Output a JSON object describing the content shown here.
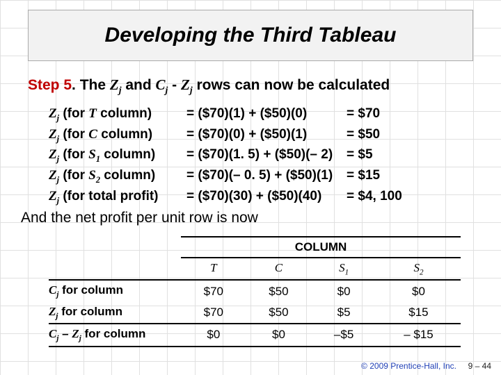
{
  "title": "Developing the Third Tableau",
  "step": {
    "label": "Step 5",
    "period": ".",
    "pre": " The ",
    "z": "Z",
    "jsub": "j",
    "and": " and ",
    "c": "C",
    "dash": " - ",
    "post": " rows can now be calculated"
  },
  "calcs": [
    {
      "lhs_var": "Z",
      "lhs_sub": "j",
      "lhs_for": " (for ",
      "lhs_col": "T",
      "lhs_tail": " column)",
      "mid": "= ($70)(1) + ($50)(0)",
      "rhs": "= $70"
    },
    {
      "lhs_var": "Z",
      "lhs_sub": "j",
      "lhs_for": " (for ",
      "lhs_col": "C",
      "lhs_tail": " column)",
      "mid": "= ($70)(0) + ($50)(1)",
      "rhs": "= $50"
    },
    {
      "lhs_var": "Z",
      "lhs_sub": "j",
      "lhs_for": " (for ",
      "lhs_col": "S",
      "lhs_colsub": "1",
      "lhs_tail": " column)",
      "mid": "= ($70)(1. 5) + ($50)(– 2)",
      "rhs": "= $5"
    },
    {
      "lhs_var": "Z",
      "lhs_sub": "j",
      "lhs_for": " (for ",
      "lhs_col": "S",
      "lhs_colsub": "2",
      "lhs_tail": " column)",
      "mid": "= ($70)(– 0. 5) + ($50)(1)",
      "rhs": "= $15"
    },
    {
      "lhs_var": "Z",
      "lhs_sub": "j",
      "lhs_for": " (for total profit)",
      "lhs_col": "",
      "lhs_tail": "",
      "mid": "= ($70)(30) + ($50)(40)",
      "rhs": "= $4, 100"
    }
  ],
  "net_line": "And the net profit per unit row is now",
  "table": {
    "column_header": "COLUMN",
    "cols": [
      {
        "name": "T",
        "sub": ""
      },
      {
        "name": "C",
        "sub": ""
      },
      {
        "name": "S",
        "sub": "1"
      },
      {
        "name": "S",
        "sub": "2"
      }
    ],
    "rows": [
      {
        "label_var": "C",
        "label_sub": "j",
        "label_tail": " for column",
        "vals": [
          "$70",
          "$50",
          "$0",
          "$0"
        ]
      },
      {
        "label_var": "Z",
        "label_sub": "j",
        "label_tail": " for column",
        "vals": [
          "$70",
          "$50",
          "$5",
          "$15"
        ]
      },
      {
        "label_var": "C",
        "label_sub": "j",
        "label_mid": " – ",
        "label_var2": "Z",
        "label_sub2": "j",
        "label_tail": " for column",
        "vals": [
          "$0",
          "$0",
          "–$5",
          "–  $15"
        ]
      }
    ]
  },
  "footer": {
    "copyright": "© 2009 Prentice-Hall, Inc.",
    "page": "9 – 44"
  }
}
